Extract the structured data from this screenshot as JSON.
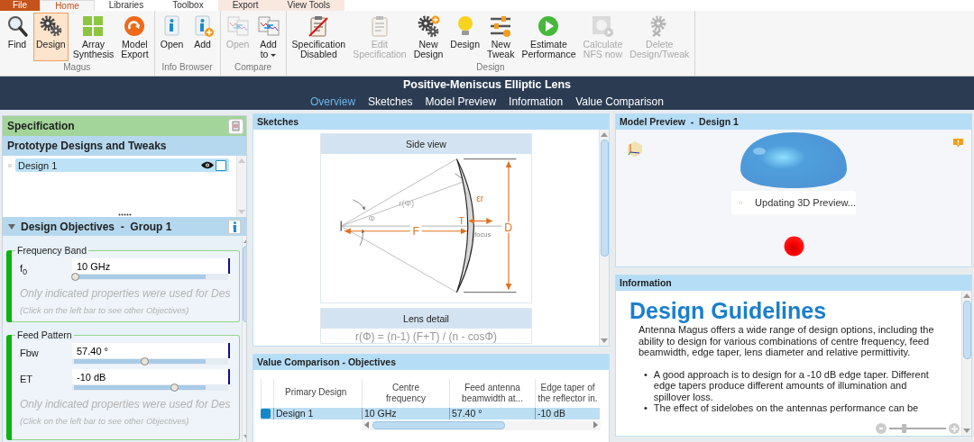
{
  "menu_tabs": [
    {
      "label": "File",
      "kind": "file",
      "selected": false
    },
    {
      "label": "Home",
      "kind": "normal",
      "selected": true
    },
    {
      "label": "Libraries",
      "kind": "normal",
      "selected": false
    },
    {
      "label": "Toolbox",
      "kind": "normal",
      "selected": false
    },
    {
      "label": "Export",
      "kind": "context",
      "selected": false
    },
    {
      "label": "View Tools",
      "kind": "context",
      "selected": false
    }
  ],
  "ribbon": {
    "groups": [
      {
        "label": "Magus",
        "buttons": [
          {
            "label": "Find",
            "selected": false,
            "disabled": false
          },
          {
            "label": "Design",
            "selected": true,
            "disabled": false
          },
          {
            "label": "Array\nSynthesis",
            "selected": false,
            "disabled": false
          },
          {
            "label": "Model\nExport",
            "selected": false,
            "disabled": false
          }
        ]
      },
      {
        "label": "Info Browser",
        "buttons": [
          {
            "label": "Open",
            "selected": false,
            "disabled": false
          },
          {
            "label": "Add",
            "selected": false,
            "disabled": false
          }
        ]
      },
      {
        "label": "Compare",
        "buttons": [
          {
            "label": "Open",
            "selected": false,
            "disabled": true
          },
          {
            "label": "Add\nto",
            "selected": false,
            "disabled": false,
            "dropdown": true
          }
        ]
      },
      {
        "label": "Design",
        "buttons": [
          {
            "label": "Specification\nDisabled",
            "selected": false,
            "disabled": false
          },
          {
            "label": "Edit\nSpecification",
            "selected": false,
            "disabled": true
          },
          {
            "label": "New\nDesign",
            "selected": false,
            "disabled": false
          },
          {
            "label": "Design",
            "selected": false,
            "disabled": false
          },
          {
            "label": "New\nTweak",
            "selected": false,
            "disabled": false
          },
          {
            "label": "Estimate\nPerformance",
            "selected": false,
            "disabled": false
          },
          {
            "label": "Calculate\nNFS now",
            "selected": false,
            "disabled": true
          },
          {
            "label": "Delete\nDesign/Tweak",
            "selected": false,
            "disabled": true
          }
        ]
      }
    ]
  },
  "header": {
    "title": "Positive-Meniscus Elliptic Lens",
    "nav": [
      {
        "label": "Overview",
        "selected": true
      },
      {
        "label": "Sketches",
        "selected": false
      },
      {
        "label": "Model Preview",
        "selected": false
      },
      {
        "label": "Information",
        "selected": false
      },
      {
        "label": "Value Comparison",
        "selected": false
      }
    ]
  },
  "specification": {
    "title": "Specification",
    "designs": {
      "title": "Prototype Designs and Tweaks",
      "items": [
        {
          "label": "Design 1",
          "selected": true,
          "checked": false
        }
      ]
    },
    "objectives": {
      "title": "Design Objectives  -  Group 1",
      "expanded": true,
      "groups": [
        {
          "title": "Frequency Band",
          "params": [
            {
              "label": "f$_{0}$",
              "value": "10 GHz",
              "level": 0.02
            }
          ],
          "note": "Only indicated properties were used for Des",
          "hint": "(Click on the left bar to see other Objectives)"
        },
        {
          "title": "Feed Pattern",
          "params": [
            {
              "label": "Fbw",
              "value": "57.40 °",
              "level": 0.46
            },
            {
              "label": "ET",
              "value": "-10 dB",
              "level": 0.65
            }
          ],
          "note": "Only indicated properties were used for Des",
          "hint": "(Click on the left bar to see other Objectives)"
        }
      ]
    }
  },
  "sketches": {
    "title": "Sketches",
    "cards": [
      {
        "title": "Side view",
        "kind": "side_view",
        "labels": {
          "r_phi": "r(Φ)",
          "phi": "Φ",
          "t": "T",
          "er": "εr",
          "f": "F",
          "focus": "focus",
          "d": "D"
        }
      },
      {
        "title": "Lens detail",
        "kind": "formula",
        "text": "r(Φ) = (n-1) (F+T) / (n - cosΦ)"
      }
    ]
  },
  "comparison": {
    "title": "Value Comparison - Objectives",
    "columns": [
      "Primary Design",
      "Centre\nfrequency",
      "Feed antenna\nbeamwidth at...",
      "Edge taper of\nthe reflector in."
    ],
    "rows": [
      {
        "color": "#1589c8",
        "selected": true,
        "cells": [
          "Design 1",
          "10 GHz",
          "57.40 °",
          "-10 dB"
        ]
      }
    ]
  },
  "model_preview": {
    "title": "Model Preview  -  Design 1",
    "status": "Updating 3D Preview..."
  },
  "information": {
    "title": "Information",
    "heading": "Design Guidelines",
    "paragraph": "Antenna Magus offers a wide range of design options, including the ability to design for various combinations of centre frequency, feed beamwidth, edge taper, lens diameter and relative permittivity.",
    "bullets": [
      {
        "marker": "•",
        "text": "A good approach is to design for a -10 dB edge taper. Different edge tapers produce different amounts of illumination and spillover loss."
      },
      {
        "marker": "•",
        "text": "The effect of sidelobes on the antennas performance can be"
      }
    ],
    "zoom": {
      "level": 0.25
    }
  }
}
